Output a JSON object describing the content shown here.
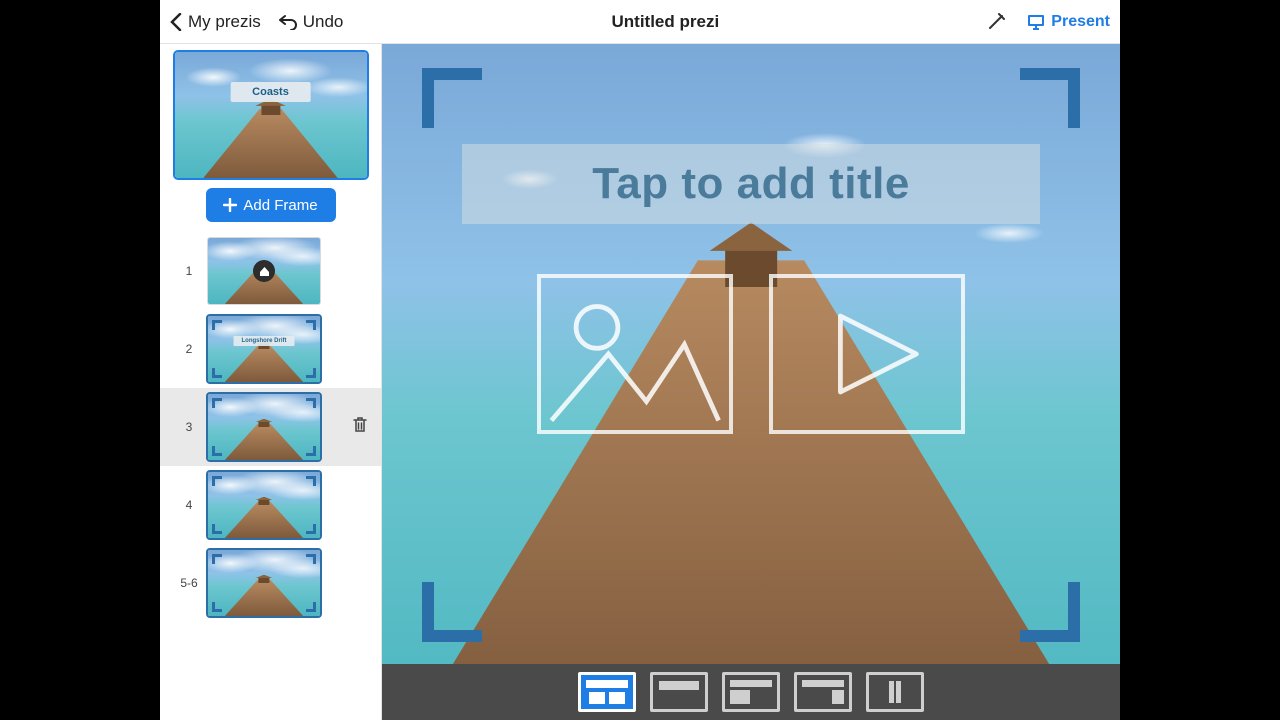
{
  "topbar": {
    "back_label": "My prezis",
    "undo_label": "Undo",
    "title": "Untitled prezi",
    "present_label": "Present"
  },
  "sidebar": {
    "overview_label": "Coasts",
    "add_frame_label": "Add Frame",
    "frames": [
      {
        "num": "1",
        "label": "",
        "selected": false,
        "home": true
      },
      {
        "num": "2",
        "label": "Longshore Drift",
        "selected": false,
        "home": false
      },
      {
        "num": "3",
        "label": "",
        "selected": true,
        "home": false
      },
      {
        "num": "4",
        "label": "",
        "selected": false,
        "home": false
      },
      {
        "num": "5-6",
        "label": "",
        "selected": false,
        "home": false
      }
    ]
  },
  "canvas": {
    "title_placeholder": "Tap to add title"
  },
  "layoutbar": {
    "options": [
      "layout-hero",
      "layout-title",
      "layout-media",
      "layout-blank",
      "layout-split"
    ],
    "selected_index": 0
  },
  "colors": {
    "accent": "#1f7de6",
    "frame": "#2b6ea8"
  }
}
